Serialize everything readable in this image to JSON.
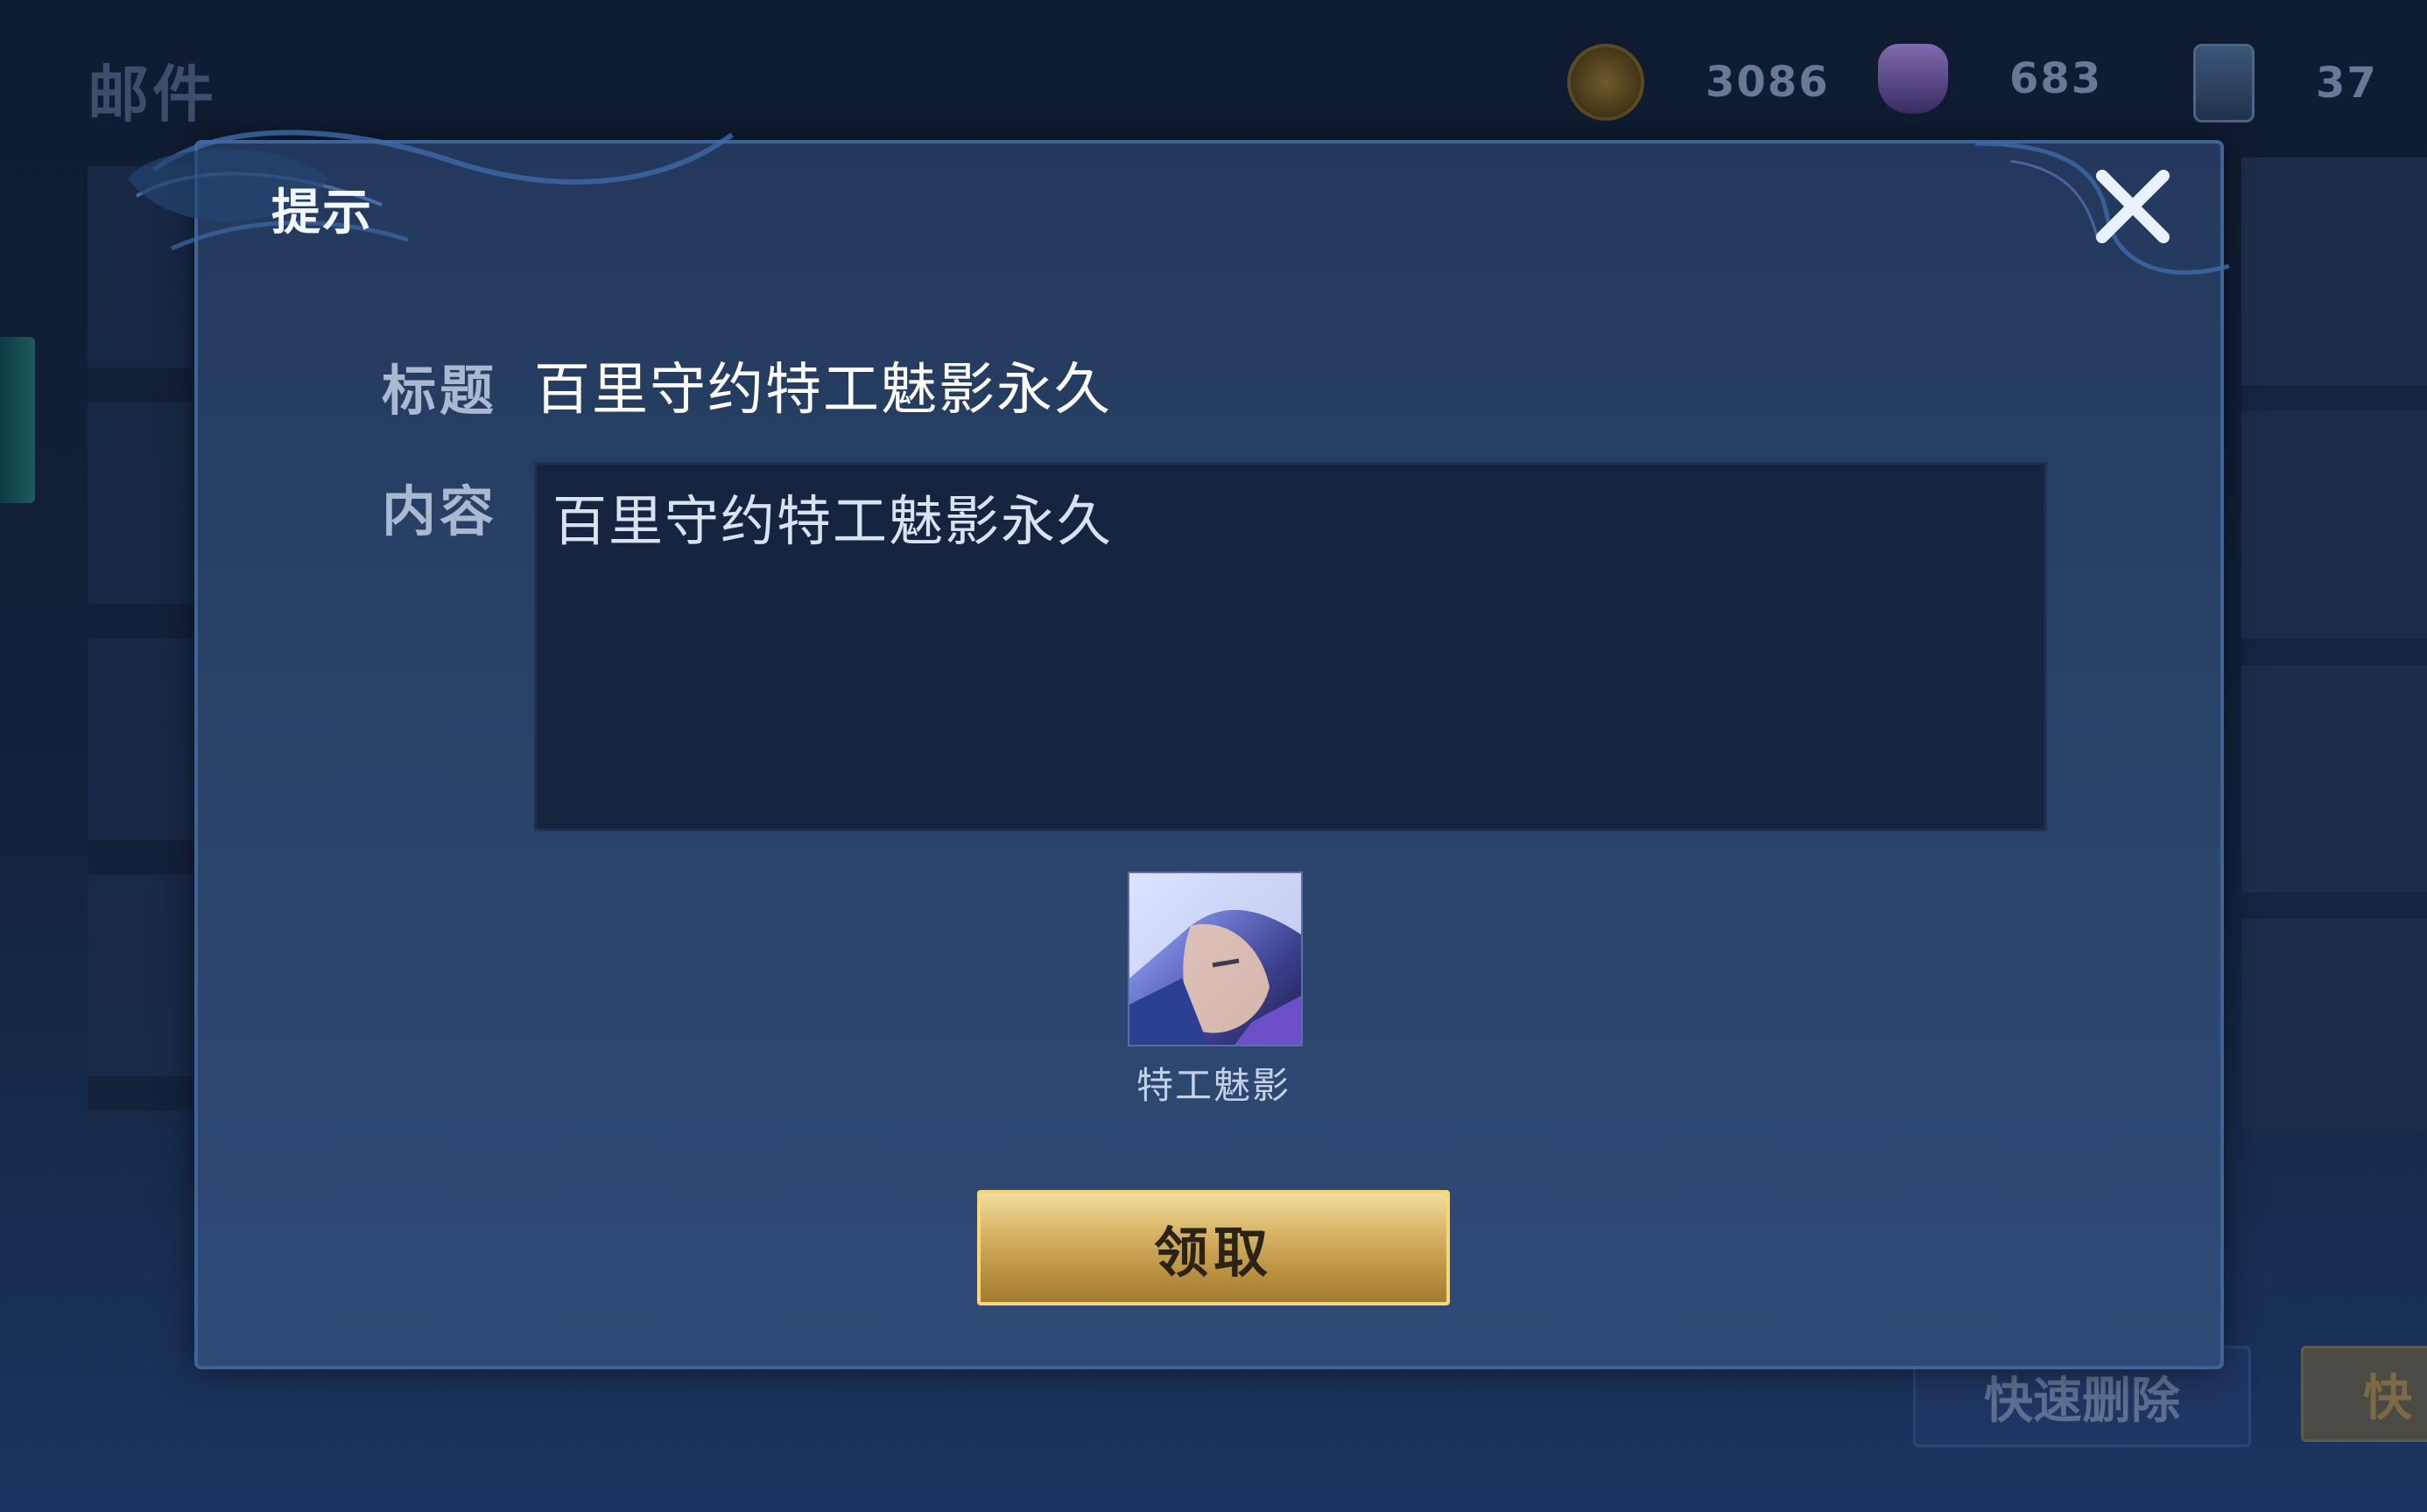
{
  "background": {
    "page_title": "邮件",
    "currencies": [
      {
        "icon": "gold-coin-icon",
        "value": "3086"
      },
      {
        "icon": "gem-icon",
        "value": "683"
      },
      {
        "icon": "ticket-icon",
        "value": "37"
      }
    ],
    "quick_delete_label": "快速删除",
    "quick_claim_label": "快"
  },
  "dialog": {
    "title": "提示",
    "subject_label": "标题",
    "subject_value": "百里守约特工魅影永久",
    "content_label": "内容",
    "content_value": "百里守约特工魅影永久",
    "reward": {
      "name": "特工魅影",
      "icon": "skin-portrait-icon"
    },
    "claim_button": "领取",
    "close_icon": "close-icon"
  },
  "colors": {
    "dialog_bg": "#2a4369",
    "dialog_border": "#3f6496",
    "claim_gold": "#d4b060",
    "content_bg": "#16243f"
  }
}
